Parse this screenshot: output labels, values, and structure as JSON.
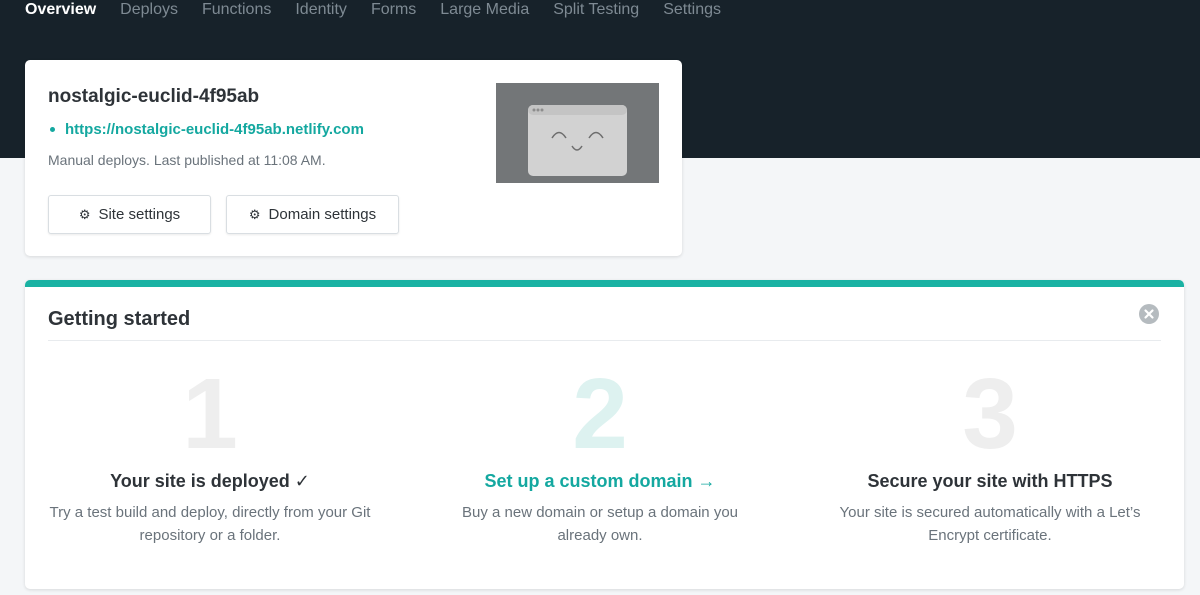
{
  "nav": {
    "items": [
      {
        "label": "Overview",
        "active": true
      },
      {
        "label": "Deploys"
      },
      {
        "label": "Functions"
      },
      {
        "label": "Identity"
      },
      {
        "label": "Forms"
      },
      {
        "label": "Large Media"
      },
      {
        "label": "Split Testing"
      },
      {
        "label": "Settings"
      }
    ]
  },
  "site": {
    "name": "nostalgic-euclid-4f95ab",
    "url": "https://nostalgic-euclid-4f95ab.netlify.com",
    "meta": "Manual deploys. Last published at 11:08 AM.",
    "site_settings_label": "Site settings",
    "domain_settings_label": "Domain settings",
    "thumbnail_icon": "browser-smiley-icon"
  },
  "getting_started": {
    "title": "Getting started",
    "steps": [
      {
        "number": "1",
        "title": "Your site is deployed ✓",
        "desc": "Try a test build and deploy, directly from your Git repository or a folder."
      },
      {
        "number": "2",
        "title": "Set up a custom domain →",
        "desc": "Buy a new domain or setup a domain you already own."
      },
      {
        "number": "3",
        "title": "Secure your site with HTTPS",
        "desc": "Your site is secured automatically with a Let’s Encrypt certificate."
      }
    ]
  },
  "colors": {
    "header_bg": "#17222a",
    "accent": "#14a8a0",
    "page_bg": "#f4f6f8"
  }
}
